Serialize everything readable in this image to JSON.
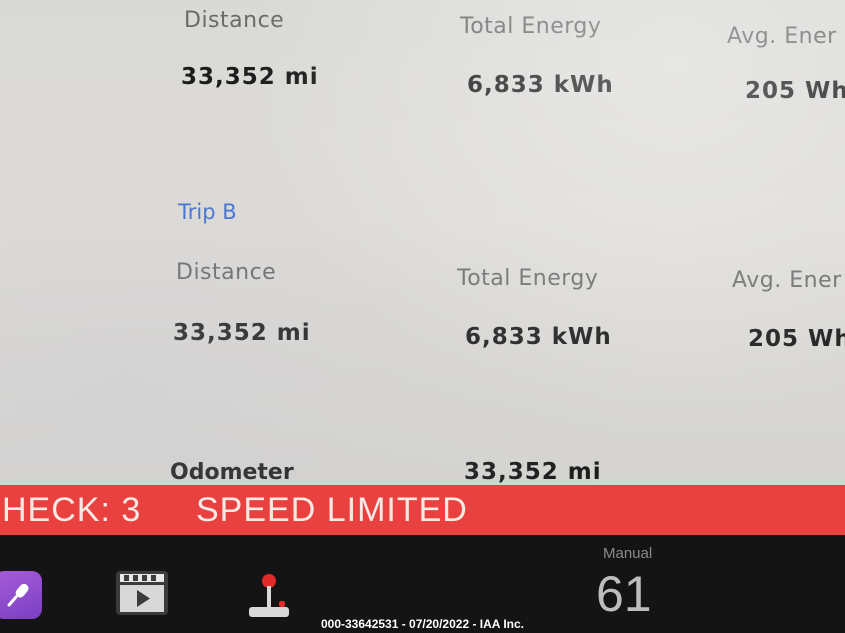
{
  "trip_a": {
    "distance_label": "Distance",
    "energy_label": "Total Energy",
    "avg_label": "Avg. Ener",
    "distance_value": "33,352  mi",
    "energy_value": "6,833  kWh",
    "avg_value": "205  Wh"
  },
  "trip_b": {
    "title": "Trip B",
    "distance_label": "Distance",
    "energy_label": "Total Energy",
    "avg_label": "Avg. Ener",
    "distance_value": "33,352  mi",
    "energy_value": "6,833  kWh",
    "avg_value": "205  Wh"
  },
  "odometer": {
    "label": "Odometer",
    "value": "33,352  mi"
  },
  "alert": {
    "check_text": "HECK: 3",
    "speed_text": "SPEED LIMITED",
    "color": "#e8413f"
  },
  "dock": {
    "icons": [
      "microphone-icon",
      "media-player-icon",
      "joystick-icon"
    ],
    "climate_mode": "Manual",
    "climate_value": "61"
  },
  "watermark": "000-33642531 - 07/20/2022 - IAA Inc."
}
